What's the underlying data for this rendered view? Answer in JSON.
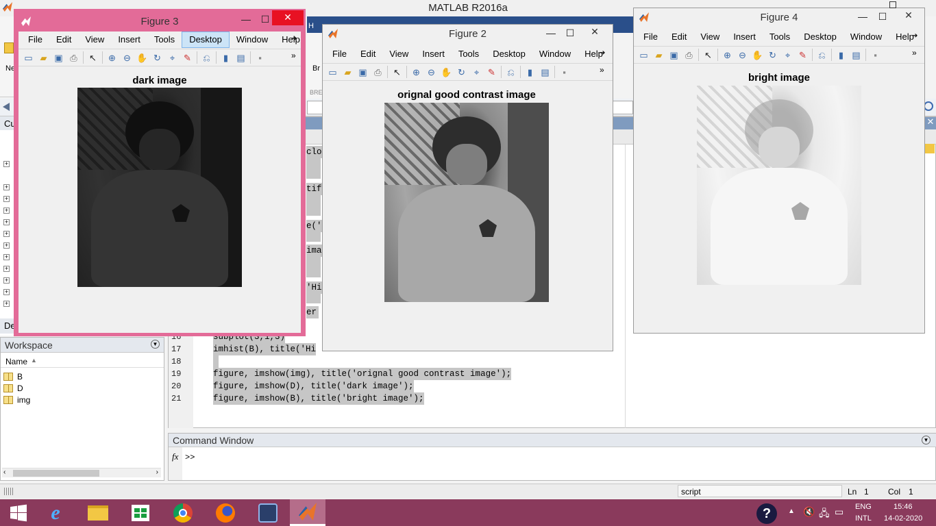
{
  "app": {
    "title": "MATLAB R2016a",
    "toolstrip_fragment_new": "Ne",
    "toolstrip_fragment_br": "Br",
    "toolstrip_fragment_bre": "BRE",
    "panel_current_folder": "Cu",
    "panel_details": "De",
    "panel_h": "H"
  },
  "workspace": {
    "title": "Workspace",
    "column_header": "Name",
    "variables": [
      "B",
      "D",
      "img"
    ]
  },
  "editor": {
    "partial_left_fragments": [
      "clos",
      "tif",
      "e('",
      "ima",
      "'Hi",
      "er"
    ],
    "lines": [
      {
        "num": "16",
        "code": "subplot(3,1,3)"
      },
      {
        "num": "17",
        "code": "imhist(B), title('Hi"
      },
      {
        "num": "18",
        "code": ""
      },
      {
        "num": "19",
        "code": "figure, imshow(img), title('orignal good contrast image');"
      },
      {
        "num": "20",
        "code": "figure, imshow(D), title('dark image');"
      },
      {
        "num": "21",
        "code": "figure, imshow(B), title('bright image');"
      }
    ]
  },
  "command_window": {
    "title": "Command Window",
    "fx_label": "fx",
    "prompt": ">>"
  },
  "statusbar": {
    "mode": "script",
    "ln_label": "Ln",
    "ln_value": "1",
    "col_label": "Col",
    "col_value": "1"
  },
  "figure_menu": [
    "File",
    "Edit",
    "View",
    "Insert",
    "Tools",
    "Desktop",
    "Window",
    "Help"
  ],
  "figures": [
    {
      "id": "fig3",
      "window_title": "Figure 3",
      "plot_title": "dark image",
      "active_menu": "Desktop"
    },
    {
      "id": "fig2",
      "window_title": "Figure 2",
      "plot_title": "orignal good contrast image"
    },
    {
      "id": "fig4",
      "window_title": "Figure 4",
      "plot_title": "bright image"
    }
  ],
  "window_controls": {
    "minimize": "—",
    "maximize": "☐",
    "close": "✕"
  },
  "taskbar": {
    "lang_top": "ENG",
    "lang_bottom": "INTL",
    "time": "15:46",
    "date": "14-02-2020",
    "help_icon_glyph": "?"
  },
  "colors": {
    "active_border": "#e36b98",
    "taskbar": "#8a3a5c",
    "editor_highlight": "#c6c6c6",
    "panel_header": "#7f9bbf"
  }
}
